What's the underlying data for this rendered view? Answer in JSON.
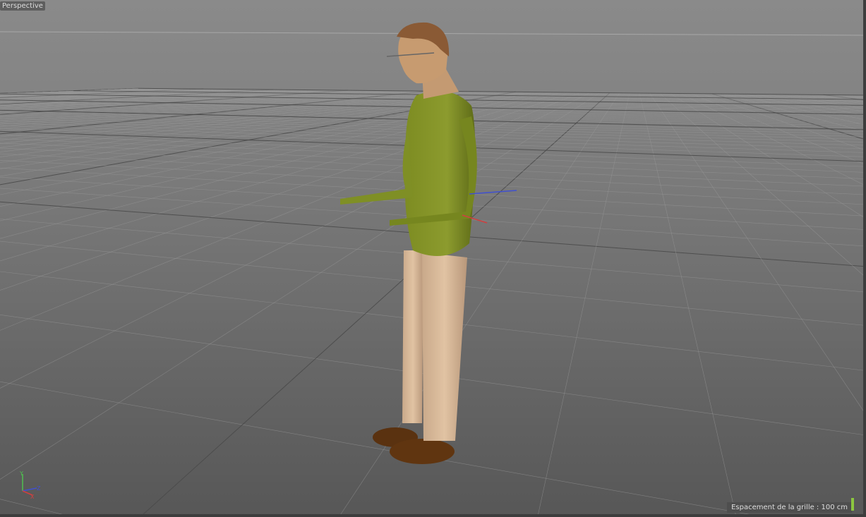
{
  "viewport": {
    "camera_label": "Perspective",
    "grid_spacing_text": "Espacement de la grille : 100 cm",
    "axes": {
      "y": "Y",
      "z": "Z",
      "x": "X"
    },
    "colors": {
      "axis_y": "#4fc04f",
      "axis_x": "#d04040",
      "axis_z": "#4050d0",
      "accent": "#8cc63f"
    }
  }
}
